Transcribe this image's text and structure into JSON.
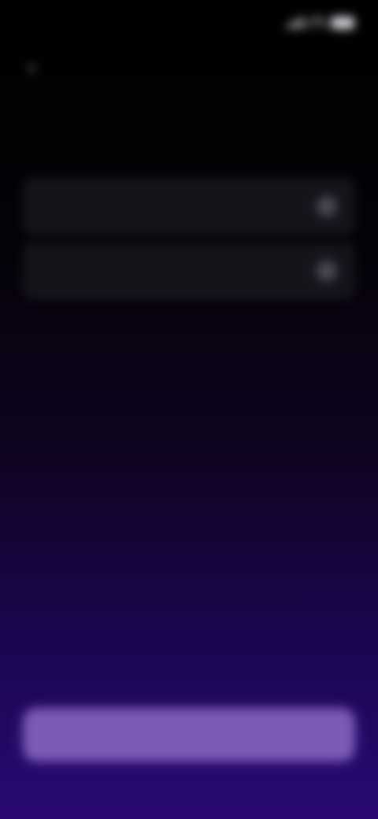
{
  "status_bar": {
    "time": "",
    "signal_icon": "signal-icon",
    "wifi_icon": "wifi-icon",
    "battery_icon": "battery-icon"
  },
  "header": {
    "back_icon": "back-arrow-icon",
    "title": ""
  },
  "options": [
    {
      "label": "",
      "icon": "toggle-icon"
    },
    {
      "label": "",
      "icon": "toggle-icon"
    }
  ],
  "footer": {
    "secondary_link": "",
    "primary_button": ""
  },
  "colors": {
    "background_top": "#000000",
    "background_bottom": "#2a0a72",
    "primary_button": "#7a5ab6",
    "card": "#16141b"
  }
}
